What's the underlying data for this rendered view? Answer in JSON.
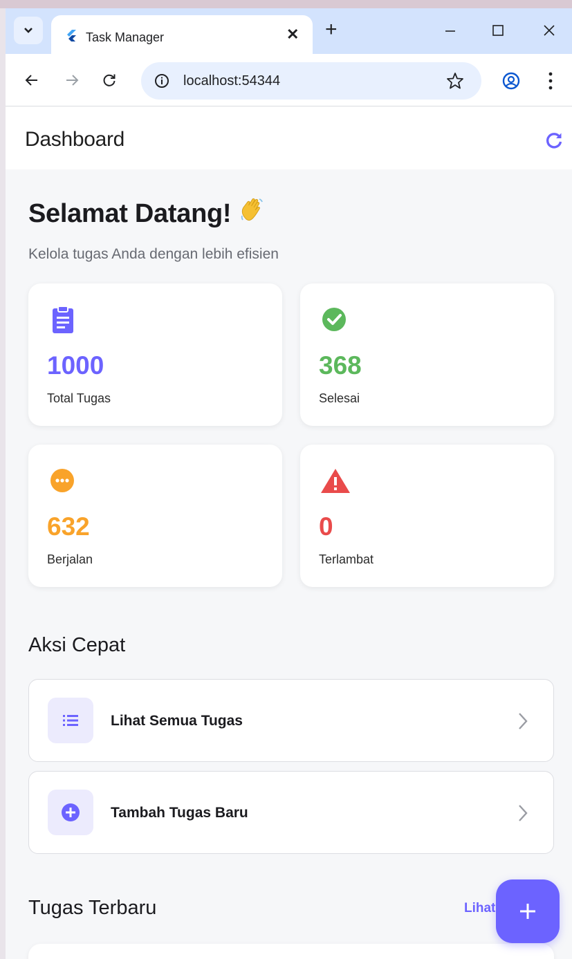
{
  "browser": {
    "tab_title": "Task Manager",
    "url": "localhost:54344",
    "new_tab_symbol": "+",
    "tab_close_symbol": "✕"
  },
  "app": {
    "title": "Dashboard",
    "welcome": "Selamat Datang!",
    "welcome_emoji": "waving-hand-icon",
    "subtitle": "Kelola tugas Anda dengan lebih efisien"
  },
  "stats": [
    {
      "value": "1000",
      "label": "Total Tugas",
      "icon": "clipboard-icon",
      "color": "#6c63ff"
    },
    {
      "value": "368",
      "label": "Selesai",
      "icon": "check-circle-icon",
      "color": "#5cb85c"
    },
    {
      "value": "632",
      "label": "Berjalan",
      "icon": "more-horiz-circle-icon",
      "color": "#f9a32a"
    },
    {
      "value": "0",
      "label": "Terlambat",
      "icon": "warning-icon",
      "color": "#e94b4b"
    }
  ],
  "quick_actions": {
    "title": "Aksi Cepat",
    "items": [
      {
        "label": "Lihat Semua Tugas",
        "icon": "list-icon"
      },
      {
        "label": "Tambah Tugas Baru",
        "icon": "add-circle-icon"
      }
    ]
  },
  "recent": {
    "title": "Tugas Terbaru",
    "see_all": "Lihat"
  },
  "colors": {
    "primary": "#6c63ff",
    "background": "#f6f7f9"
  }
}
